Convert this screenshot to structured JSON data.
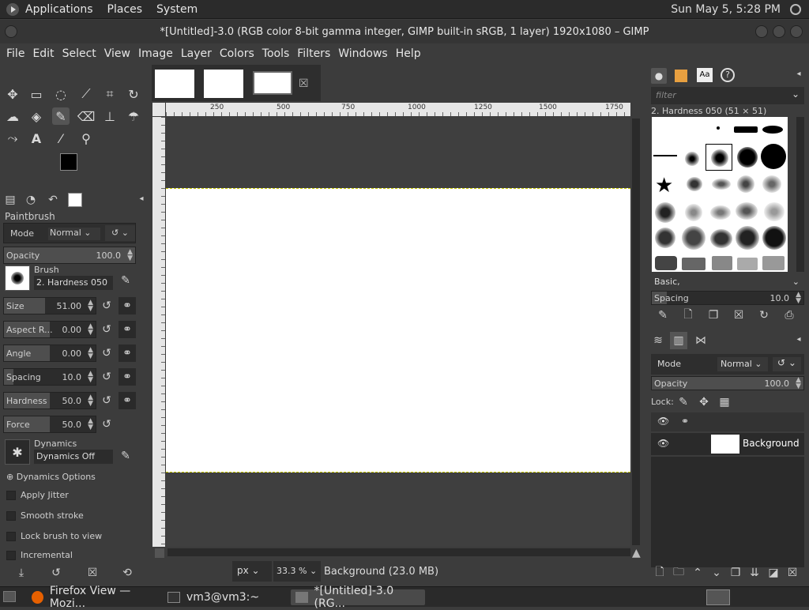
{
  "topbar": {
    "applications": "Applications",
    "places": "Places",
    "system": "System",
    "clock": "Sun May  5, 5:28 PM"
  },
  "window": {
    "title": "*[Untitled]-3.0 (RGB color 8-bit gamma integer, GIMP built-in sRGB, 1 layer) 1920x1080 – GIMP"
  },
  "menubar": [
    "File",
    "Edit",
    "Select",
    "View",
    "Image",
    "Layer",
    "Colors",
    "Tools",
    "Filters",
    "Windows",
    "Help"
  ],
  "tool_options": {
    "title": "Paintbrush",
    "mode_label": "Mode",
    "mode_value": "Normal",
    "opacity_label": "Opacity",
    "opacity_value": "100.0",
    "brush_label": "Brush",
    "brush_value": "2. Hardness 050",
    "sliders": [
      {
        "label": "Size",
        "value": "51.00",
        "level": 0.45
      },
      {
        "label": "Aspect R...",
        "value": "0.00",
        "level": 0.5
      },
      {
        "label": "Angle",
        "value": "0.00",
        "level": 0.5
      },
      {
        "label": "Spacing",
        "value": "10.0",
        "level": 0.1
      },
      {
        "label": "Hardness",
        "value": "50.0",
        "level": 0.5
      },
      {
        "label": "Force",
        "value": "50.0",
        "level": 0.5
      }
    ],
    "dynamics_label": "Dynamics",
    "dynamics_value": "Dynamics Off",
    "dynamics_options": "Dynamics Options",
    "apply_jitter": "Apply Jitter",
    "smooth_stroke": "Smooth stroke",
    "lock_brush": "Lock brush to view",
    "incremental": "Incremental"
  },
  "ruler": {
    "ticks": [
      "250",
      "500",
      "750",
      "1000",
      "1250",
      "1500",
      "1750"
    ]
  },
  "statusbar": {
    "unit": "px",
    "zoom": "33.3 %",
    "message": "Background (23.0 MB)"
  },
  "brushes": {
    "filter_placeholder": "filter",
    "selected": "2. Hardness 050 (51 × 51)",
    "tag": "Basic,",
    "spacing_label": "Spacing",
    "spacing_value": "10.0"
  },
  "layers": {
    "mode_label": "Mode",
    "mode_value": "Normal",
    "opacity_label": "Opacity",
    "opacity_value": "100.0",
    "lock_label": "Lock:",
    "layer_name": "Background"
  },
  "taskbar": [
    {
      "label": "Firefox View — Mozi..."
    },
    {
      "label": "vm3@vm3:~"
    },
    {
      "label": "*[Untitled]-3.0 (RG..."
    }
  ],
  "colors": {
    "fg": "#000000",
    "bg": "#ffffff",
    "accent": "#c8c800"
  }
}
